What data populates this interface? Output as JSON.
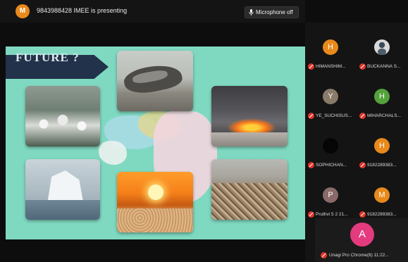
{
  "presenter": {
    "initial": "M",
    "status_text": "9843988428 IMEE is presenting"
  },
  "toolbar": {
    "mic_label": "Microphone off"
  },
  "slide": {
    "title": "FUTURE ?",
    "background_color": "#7fd9c1",
    "banner_color": "#22324a",
    "photos": [
      "plastic-bottles-ice-photo",
      "whale-carcass-photo",
      "burning-waste-photo",
      "iceberg-photo",
      "sunset-photo",
      "waste-dump-photo"
    ]
  },
  "participants": [
    {
      "initial": "H",
      "name": "HIMANSHIM...",
      "color": "#e8891b"
    },
    {
      "initial": "",
      "name": "BUCKANNA S...",
      "color": "#cfcfcf"
    },
    {
      "initial": "Y",
      "name": "YE_SUCHISUS...",
      "color": "#8a7a6a"
    },
    {
      "initial": "H",
      "name": "MIHARCHALS...",
      "color": "#54a23c"
    },
    {
      "initial": "",
      "name": "SOPHICHAN...",
      "color": "#050505"
    },
    {
      "initial": "H",
      "name": "9182289383...",
      "color": "#e8891b"
    },
    {
      "initial": "P",
      "name": "Pruthvi 5 2 21...",
      "color": "#8a6a6a"
    },
    {
      "initial": "M",
      "name": "9182289383...",
      "color": "#e8891b"
    }
  ],
  "self": {
    "initial": "A",
    "name": "Unagi Pro Chrome(8) 11:22..."
  }
}
